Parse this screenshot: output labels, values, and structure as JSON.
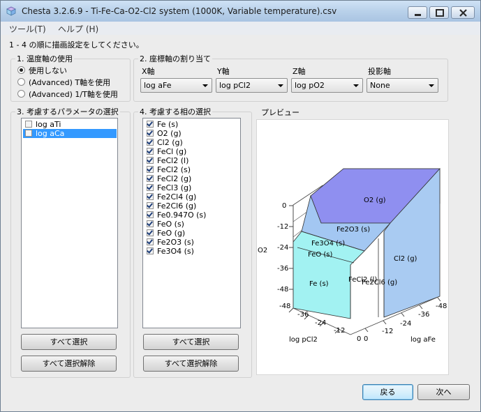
{
  "window": {
    "title": "Chesta 3.2.6.9 - Ti-Fe-Ca-O2-Cl2 system (1000K, Variable temperature).csv"
  },
  "menu": [
    "ツール(T)",
    "ヘルプ (H)"
  ],
  "instruction": "1 - 4 の順に描画設定をしてください。",
  "temperature_axis": {
    "label": "1. 温度軸の使用",
    "options": [
      {
        "label": "使用しない",
        "selected": true
      },
      {
        "label": "(Advanced) T軸を使用",
        "selected": false
      },
      {
        "label": "(Advanced) 1/T軸を使用",
        "selected": false
      }
    ]
  },
  "axes": {
    "label": "2. 座標軸の割り当て",
    "x": {
      "label": "X軸",
      "value": "log aFe"
    },
    "y": {
      "label": "Y軸",
      "value": "log pCl2"
    },
    "z": {
      "label": "Z軸",
      "value": "log pO2"
    },
    "projection": {
      "label": "投影軸",
      "value": "None"
    }
  },
  "parameters": {
    "label": "3. 考慮するパラメータの選択",
    "items": [
      {
        "label": "log aTi",
        "checked": false,
        "selected": false
      },
      {
        "label": "log aCa",
        "checked": false,
        "selected": true
      }
    ],
    "select_all": "すべて選択",
    "deselect_all": "すべて選択解除"
  },
  "phases": {
    "label": "4. 考慮する相の選択",
    "items": [
      {
        "label": "Fe (s)",
        "checked": true
      },
      {
        "label": "O2 (g)",
        "checked": true
      },
      {
        "label": "Cl2 (g)",
        "checked": true
      },
      {
        "label": "FeCl (g)",
        "checked": true
      },
      {
        "label": "FeCl2 (l)",
        "checked": true
      },
      {
        "label": "FeCl2 (s)",
        "checked": true
      },
      {
        "label": "FeCl2 (g)",
        "checked": true
      },
      {
        "label": "FeCl3 (g)",
        "checked": true
      },
      {
        "label": "Fe2Cl4 (g)",
        "checked": true
      },
      {
        "label": "Fe2Cl6 (g)",
        "checked": true
      },
      {
        "label": "Fe0.947O (s)",
        "checked": true
      },
      {
        "label": "FeO (s)",
        "checked": true
      },
      {
        "label": "FeO (g)",
        "checked": true
      },
      {
        "label": "Fe2O3 (s)",
        "checked": true
      },
      {
        "label": "Fe3O4 (s)",
        "checked": true
      }
    ],
    "select_all": "すべて選択",
    "deselect_all": "すべて選択解除"
  },
  "preview": {
    "label": "プレビュー",
    "z_axis_title": "O2",
    "z_ticks": [
      "0",
      "-12",
      "-24",
      "-36",
      "-48"
    ],
    "y_axis_title": "log pCl2",
    "y_ticks": [
      "-48",
      "-36",
      "-24",
      "-12",
      "0"
    ],
    "x_axis_title": "log aFe",
    "x_ticks": [
      "0",
      "-12",
      "-24",
      "-36",
      "-48"
    ],
    "regions": [
      "O2 (g)",
      "Fe2O3 (s)",
      "Fe3O4 (s)",
      "FeO (s)",
      "Fe (s)",
      "FeCl2 (l)",
      "Fe2Cl6 (g)",
      "Cl2 (g)"
    ],
    "colors": {
      "top": "#8f8ff0",
      "front_left": "#a2f2f2",
      "right": "#a9cbf2",
      "fe2o3": "#a3c7f2"
    }
  },
  "footer": {
    "back": "戻る",
    "next": "次へ"
  }
}
